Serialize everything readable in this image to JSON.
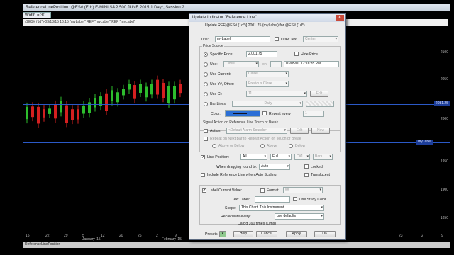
{
  "window": {
    "title": "ReferenceLinePosition: @ES#  (Ed*) E-MINI S&P 500 JUNE 2015  1 Day*, Session 2",
    "width_label": "Width = 30",
    "instrument_bar": "@ES# (1d*)-03/13/15 16:15  \"myLabel\"  REF \"myLabel\"  REF \"myLabel\"",
    "status": "ReferenceLinePosition",
    "y_ticks": [
      "2100",
      "2050",
      "2000",
      "1950",
      "1900",
      "1850"
    ],
    "x_ticks": [
      "15",
      "22",
      "29",
      "5",
      "12",
      "20",
      "26",
      "2",
      "9",
      "16",
      "23",
      "2",
      "9"
    ],
    "x_months": [
      "January '15",
      "February '15"
    ],
    "price_tags": [
      "2081.25",
      "myLabel"
    ],
    "colors": {
      "line": "#2b59c7",
      "up": "#2dbd2d",
      "down": "#d42020"
    }
  },
  "dialog": {
    "title": "Update Indicator \"Reference Line\"",
    "header": "Update REF[@ES# (1d*)] 2001.75 (myLabel) for @ES# (1d*)",
    "title_label": "Title:",
    "title_value": "myLabel",
    "draw_text": "Draw Text",
    "draw_text_pos": "Center",
    "price_source_group": "Price Source",
    "specific_price": "Specific Price:",
    "specific_price_value": "2,001.75",
    "hide_price": "Hide Price",
    "use": "Use:",
    "use_value": "Close",
    "on": "on",
    "use_datetime": "03/05/01 17:16:35 PM",
    "use_current": "Use Current:",
    "use_current_value": "Close",
    "use_ya_other": "Use Y#, Other:",
    "use_ya_value": "Previous Close",
    "use_ci": "Use CI:",
    "use_ci_value": "11",
    "use_ci_btn": "Edit",
    "bar_lines": "Bar Lines",
    "bar_lines_value": "Daily",
    "color_label": "Color:",
    "repeat_every": "Repeat every",
    "repeat_value": "1",
    "signal_group": "Signal Action on Reference Line Touch or Break",
    "action": "Action:",
    "action_value": "<Default Alarm Sounds>",
    "edit": "Edit",
    "new": "New",
    "repeat_touch": "Repeat on Next Bar to Repeat Action on Touch or Break",
    "above_or_below": "Above or Below",
    "above": "Above",
    "below": "Below",
    "line_position": "Line Position:",
    "line_position_value": "All",
    "line_style": "Full",
    "line_width": "C#1",
    "line_type": "Bars",
    "drag_round": "When dragging round to:",
    "drag_round_value": "Auto",
    "locked": "Locked",
    "include_autoscale": "Include Reference Line when Auto Scaling",
    "translucent": "Translucent",
    "label_current_value": "Label Current Value:",
    "format": "Format:",
    "format_value": "##",
    "text_label": "Text Label:",
    "use_study_color": "Use Study Color",
    "scope": "Scope:",
    "scope_value": "This Chart, This Instrument",
    "recalculate": "Recalculate every:",
    "recalculate_value": "use defaults",
    "calc_note": "Calc'd 390 times (Oms)",
    "presets": "Presets",
    "help": "Help",
    "cancel": "Cancel",
    "apply": "Apply",
    "ok": "OK"
  }
}
